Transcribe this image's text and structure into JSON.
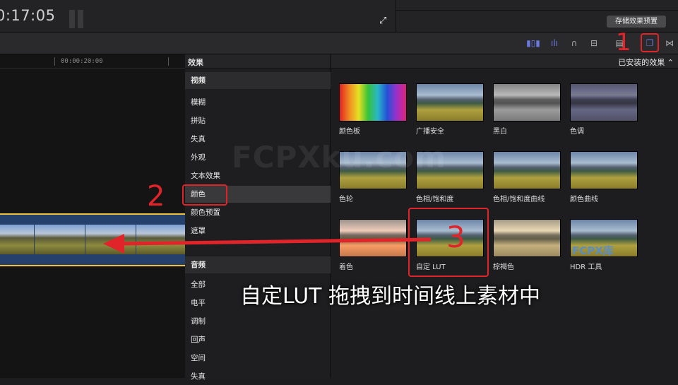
{
  "topbar": {
    "timecode": "0:17:05",
    "save_preset_label": "存储效果预置"
  },
  "timeline": {
    "ruler_time": "00:00:20:00"
  },
  "effects_sidebar": {
    "header": "效果",
    "items": [
      {
        "label": "视频",
        "kind": "category"
      },
      {
        "label": "模糊",
        "kind": "item"
      },
      {
        "label": "拼贴",
        "kind": "item"
      },
      {
        "label": "失真",
        "kind": "item"
      },
      {
        "label": "外观",
        "kind": "item"
      },
      {
        "label": "文本效果",
        "kind": "item"
      },
      {
        "label": "颜色",
        "kind": "item",
        "selected": true
      },
      {
        "label": "颜色预置",
        "kind": "item"
      },
      {
        "label": "遮罩",
        "kind": "item"
      },
      {
        "label": "音频",
        "kind": "category"
      },
      {
        "label": "全部",
        "kind": "item"
      },
      {
        "label": "电平",
        "kind": "item"
      },
      {
        "label": "调制",
        "kind": "item"
      },
      {
        "label": "回声",
        "kind": "item"
      },
      {
        "label": "空间",
        "kind": "item"
      },
      {
        "label": "失真",
        "kind": "item"
      }
    ]
  },
  "browser": {
    "filter_label": "已安装的效果",
    "tiles": [
      {
        "label": "颜色板"
      },
      {
        "label": "广播安全"
      },
      {
        "label": "黑白"
      },
      {
        "label": "色调"
      },
      {
        "label": "色轮"
      },
      {
        "label": "色相/饱和度"
      },
      {
        "label": "色相/饱和度曲线"
      },
      {
        "label": "颜色曲线"
      },
      {
        "label": "着色"
      },
      {
        "label": "自定 LUT"
      },
      {
        "label": "棕褐色"
      },
      {
        "label": "HDR 工具"
      }
    ]
  },
  "annotations": {
    "step1": "1",
    "step2": "2",
    "step3": "3",
    "caption": "自定LUT 拖拽到时间线上素材中",
    "watermark": "FCPXku.com",
    "logo": "FCPX库"
  },
  "colors": {
    "annotation_red": "#e0242a",
    "clip_border": "#f0c23a",
    "accent_blue": "#6b78e0"
  },
  "toolbar_icons": [
    "video-waveform-icon",
    "audio-waveform-icon",
    "headphones-icon",
    "split-icon",
    "filmstrip-icon",
    "effects-browser-icon",
    "transitions-icon"
  ]
}
